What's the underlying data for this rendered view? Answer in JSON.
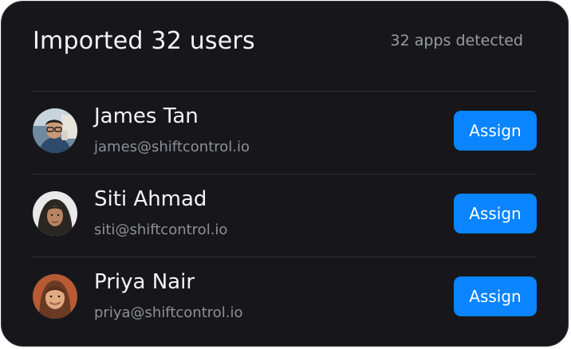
{
  "header": {
    "title": "Imported 32 users",
    "apps_detected": "32 apps detected"
  },
  "users": [
    {
      "name": "James Tan",
      "email": "james@shiftcontrol.io",
      "action_label": "Assign",
      "avatar_icon": "avatar-photo-man-glasses"
    },
    {
      "name": "Siti Ahmad",
      "email": "siti@shiftcontrol.io",
      "action_label": "Assign",
      "avatar_icon": "avatar-photo-woman-hijab"
    },
    {
      "name": "Priya Nair",
      "email": "priya@shiftcontrol.io",
      "action_label": "Assign",
      "avatar_icon": "avatar-photo-woman-smiling"
    }
  ],
  "colors": {
    "card_background": "#17171b",
    "primary_text": "#f4f4f6",
    "secondary_text": "#8e8f97",
    "accent_button": "#0a84ff",
    "divider": "#2f2f35"
  }
}
